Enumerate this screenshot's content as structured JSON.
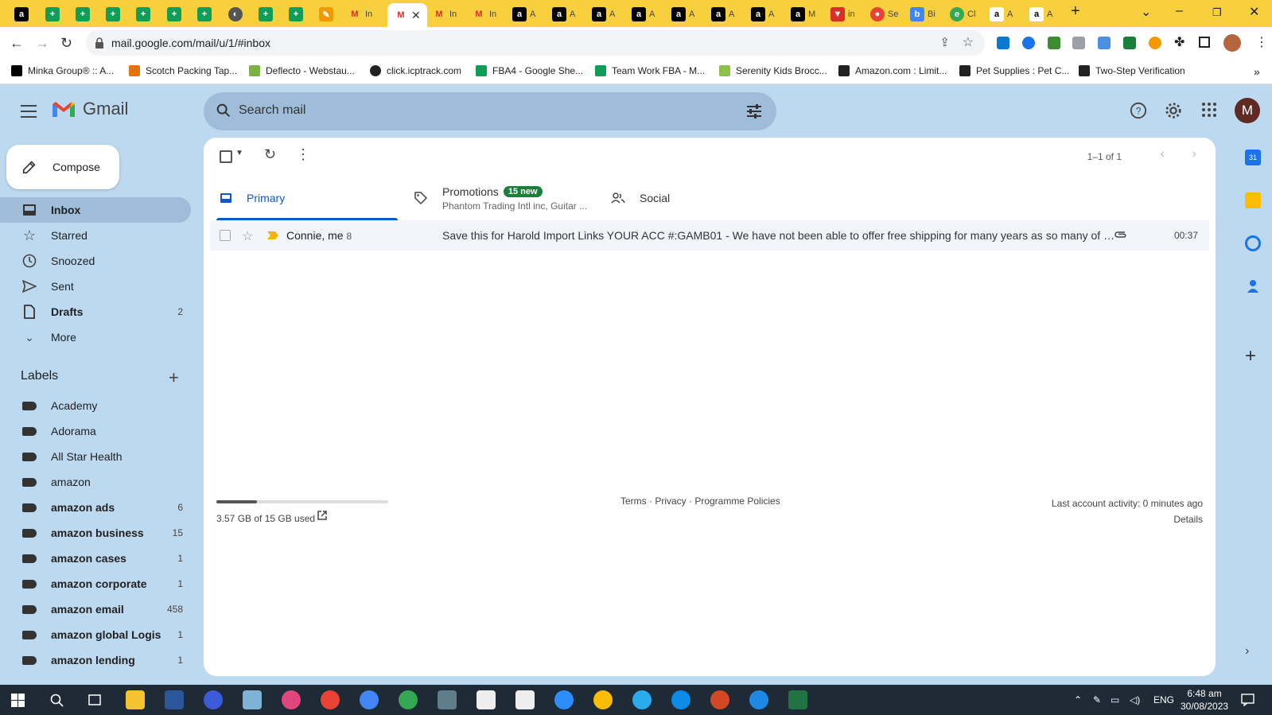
{
  "browser": {
    "url": "mail.google.com/mail/u/1/#inbox",
    "tabs": [
      {
        "label": "In",
        "icon": "gmail-icon"
      },
      {
        "label": "In",
        "icon": "gmail-icon"
      },
      {
        "label": "In",
        "icon": "gmail-icon"
      },
      {
        "label": "In",
        "icon": "gmail-icon"
      },
      {
        "label": "A",
        "icon": "amazon-icon"
      },
      {
        "label": "A",
        "icon": "amazon-icon"
      },
      {
        "label": "A",
        "icon": "amazon-icon"
      },
      {
        "label": "A",
        "icon": "amazon-icon"
      },
      {
        "label": "A",
        "icon": "amazon-icon"
      },
      {
        "label": "A",
        "icon": "amazon-icon"
      },
      {
        "label": "A",
        "icon": "amazon-icon"
      },
      {
        "label": "M",
        "icon": "amazon-icon"
      },
      {
        "label": "in",
        "icon": "tab-icon"
      },
      {
        "label": "Se",
        "icon": "tab-icon"
      },
      {
        "label": "Bi",
        "icon": "tab-icon"
      },
      {
        "label": "Cl",
        "icon": "tab-icon"
      },
      {
        "label": "A",
        "icon": "amazon-icon"
      },
      {
        "label": "A",
        "icon": "amazon-icon"
      }
    ],
    "bookmarks": [
      {
        "label": "Minka Group® :: A...",
        "color": "#000000"
      },
      {
        "label": "Scotch Packing Tap...",
        "color": "#e8710a"
      },
      {
        "label": "Deflecto - Webstau...",
        "color": "#7cb342"
      },
      {
        "label": "click.icptrack.com",
        "color": "#222222"
      },
      {
        "label": "FBA4 - Google She...",
        "color": "#0f9d58"
      },
      {
        "label": "Team Work FBA - M...",
        "color": "#0f9d58"
      },
      {
        "label": "Serenity Kids Brocc...",
        "color": "#8bc34a"
      },
      {
        "label": "Amazon.com : Limit...",
        "color": "#222222"
      },
      {
        "label": "Pet Supplies : Pet C...",
        "color": "#222222"
      },
      {
        "label": "Two-Step Verification",
        "color": "#222222"
      }
    ]
  },
  "gmail": {
    "app_name": "Gmail",
    "search_placeholder": "Search mail",
    "avatar_letter": "M",
    "compose_label": "Compose",
    "nav": [
      {
        "label": "Inbox",
        "count": "",
        "icon": "inbox-icon"
      },
      {
        "label": "Starred",
        "count": "",
        "icon": "star-icon"
      },
      {
        "label": "Snoozed",
        "count": "",
        "icon": "clock-icon"
      },
      {
        "label": "Sent",
        "count": "",
        "icon": "send-icon"
      },
      {
        "label": "Drafts",
        "count": "2",
        "icon": "draft-icon"
      },
      {
        "label": "More",
        "count": "",
        "icon": "chevron-down-icon"
      }
    ],
    "labels_title": "Labels",
    "labels": [
      {
        "label": "Academy",
        "count": ""
      },
      {
        "label": "Adorama",
        "count": ""
      },
      {
        "label": "All Star Health",
        "count": ""
      },
      {
        "label": "amazon",
        "count": ""
      },
      {
        "label": "amazon ads",
        "count": "6"
      },
      {
        "label": "amazon business",
        "count": "15"
      },
      {
        "label": "amazon cases",
        "count": "1"
      },
      {
        "label": "amazon corporate",
        "count": "1"
      },
      {
        "label": "amazon email",
        "count": "458"
      },
      {
        "label": "amazon global Logis",
        "count": "1"
      },
      {
        "label": "amazon lending",
        "count": "1"
      }
    ],
    "page_count": "1–1 of 1",
    "tabs": {
      "primary": "Primary",
      "promotions": "Promotions",
      "promotions_badge": "15 new",
      "promotions_sub": "Phantom Trading Intl inc, Guitar ...",
      "social": "Social"
    },
    "emails": [
      {
        "sender": "Connie, me",
        "count": "8",
        "subject": "Save this for Harold Import Links YOUR ACC #:GAMB01 - We have not been able to offer free shipping for many years as so many of o...",
        "time": "00:37"
      }
    ],
    "storage": {
      "text": "3.57 GB of 15 GB used",
      "fraction": 0.238
    },
    "footer": {
      "links": "Terms · Privacy · Programme Policies",
      "activity": "Last account activity: 0 minutes ago",
      "details": "Details"
    }
  },
  "taskbar": {
    "language": "ENG",
    "time": "6:48 am",
    "date": "30/08/2023"
  }
}
